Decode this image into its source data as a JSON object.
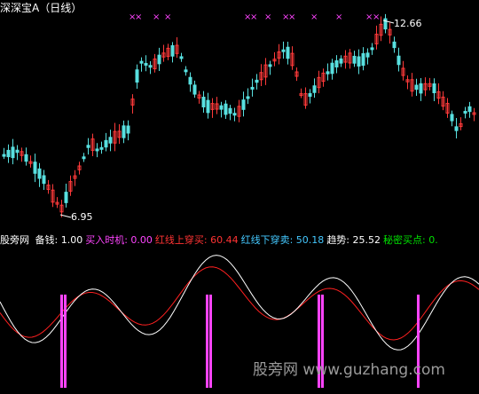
{
  "title": "深深宝A（日线）",
  "price": {
    "high_label": "12.66",
    "low_label": "6.95",
    "sell_marker": "×"
  },
  "indicator": {
    "name": "股旁网",
    "items": [
      {
        "label": "备钱:",
        "value": "1.00",
        "color": "#ffffff"
      },
      {
        "label": "买入时机:",
        "value": "0.00",
        "color": "#ff44ff"
      },
      {
        "label": "红线上穿买:",
        "value": "60.44",
        "color": "#ff3333"
      },
      {
        "label": "红线下穿卖:",
        "value": "50.18",
        "color": "#44c8ff"
      },
      {
        "label": "趋势:",
        "value": "25.52",
        "color": "#ffffff"
      },
      {
        "label": "秘密买点:",
        "value": "0.",
        "color": "#00e000"
      }
    ]
  },
  "watermark": "股旁网 www.guzhang.com",
  "colors": {
    "up": "#ff3a3a",
    "down": "#58e0e0",
    "marker": "#ff44ff",
    "red_line": "#ff2020",
    "white_line": "#ffffff",
    "bar": "#ff44ff"
  }
}
